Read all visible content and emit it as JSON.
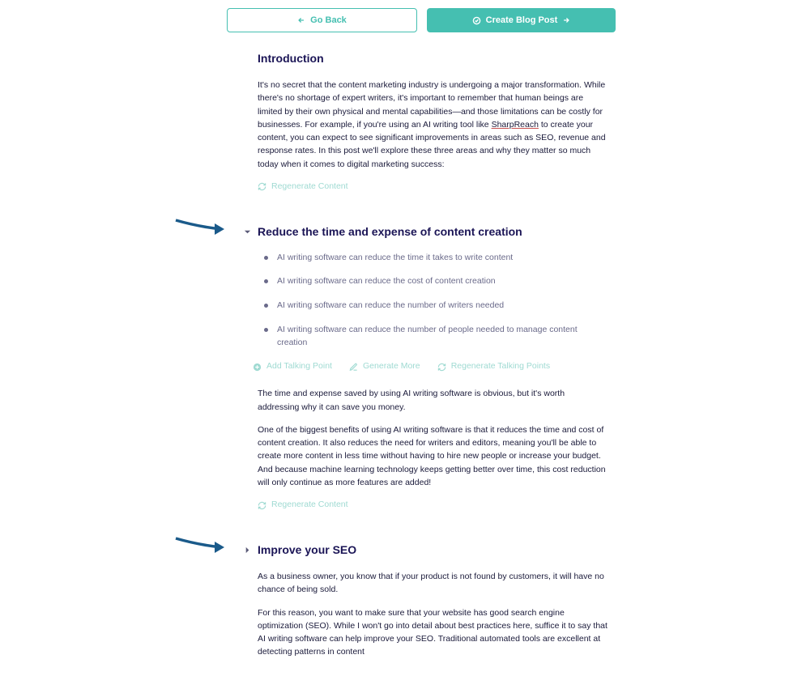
{
  "buttons": {
    "go_back": "Go Back",
    "create_post": "Create Blog Post"
  },
  "intro": {
    "title": "Introduction",
    "tool_name": "SharpReach",
    "body_before_link": "It's no secret that the content marketing industry is undergoing a major transformation. While there's no shortage of expert writers, it's important to remember that human beings are limited by their own physical and mental capabilities—and those limitations can be costly for businesses. For example, if you're using an AI writing tool like ",
    "body_after_link": " to create your content, you can expect to see significant improvements in areas such as SEO, revenue and response rates. In this post we'll explore these three areas and why they matter so much today when it comes to digital marketing success:"
  },
  "actions": {
    "regenerate_content": "Regenerate Content",
    "add_talking_point": "Add Talking Point",
    "generate_more": "Generate More",
    "regenerate_talking_points": "Regenerate Talking Points"
  },
  "section_reduce": {
    "title": "Reduce the time and expense of content creation",
    "points": [
      "AI writing software can reduce the time it takes to write content",
      "AI writing software can reduce the cost of content creation",
      "AI writing software can reduce the number of writers needed",
      "AI writing software can reduce the number of people needed to manage content creation"
    ],
    "para1": "The time and expense saved by using AI writing software is obvious, but it's worth addressing why it can save you money.",
    "para2": "One of the biggest benefits of using AI writing software is that it reduces the time and cost of content creation. It also reduces the need for writers and editors, meaning you'll be able to create more content in less time without having to hire new people or increase your budget. And because machine learning technology keeps getting better over time, this cost reduction will only continue as more features are added!"
  },
  "section_seo": {
    "title": "Improve your SEO",
    "para1": "As a business owner, you know that if your product is not found by customers, it will have no chance of being sold.",
    "para2": "For this reason, you want to make sure that your website has good search engine optimization (SEO). While I won't go into detail about best practices here, suffice it to say that AI writing software can help improve your SEO. Traditional automated tools are excellent at detecting patterns in content"
  }
}
